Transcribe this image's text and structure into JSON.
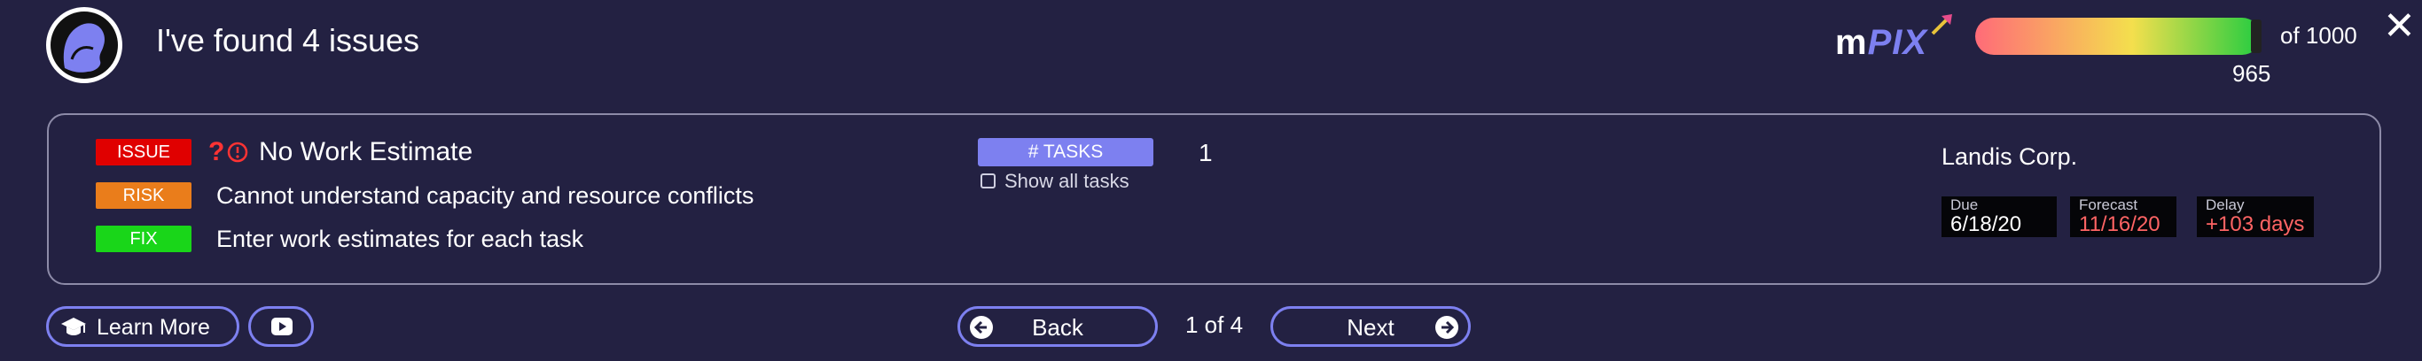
{
  "header": {
    "title": "I've found 4 issues",
    "logo": {
      "m": "m",
      "pix": "PIX"
    },
    "score": {
      "value": "965",
      "max_label": "of 1000",
      "fraction": 0.965
    },
    "close_label": "✕"
  },
  "issue": {
    "badge_issue": "ISSUE",
    "badge_risk": "RISK",
    "badge_fix": "FIX",
    "question_mark": "?",
    "title": "No Work Estimate",
    "risk": "Cannot understand capacity and resource conflicts",
    "fix": "Enter work estimates for each task"
  },
  "tasks": {
    "button_label": "# TASKS",
    "count": "1",
    "show_all_label": "Show all tasks",
    "show_all_checked": false
  },
  "project": {
    "company": "Landis Corp.",
    "due_label": "Due",
    "due_value": "6/18/20",
    "forecast_label": "Forecast",
    "forecast_value": "11/16/20",
    "delay_label": "Delay",
    "delay_value": "+103 days"
  },
  "footer": {
    "learn_more": "Learn More",
    "back": "Back",
    "page": "1 of 4",
    "next": "Next"
  },
  "colors": {
    "background": "#232142",
    "accent": "#7d80f0",
    "issue": "#e00000",
    "risk": "#ea7d1b",
    "fix": "#19d619",
    "alert_text": "#ff6464"
  },
  "icons": [
    "avatar-icon",
    "mpix-arrow-icon",
    "close-icon",
    "clock-alert-icon",
    "graduation-cap-icon",
    "video-icon",
    "arrow-left-icon",
    "arrow-right-icon"
  ]
}
